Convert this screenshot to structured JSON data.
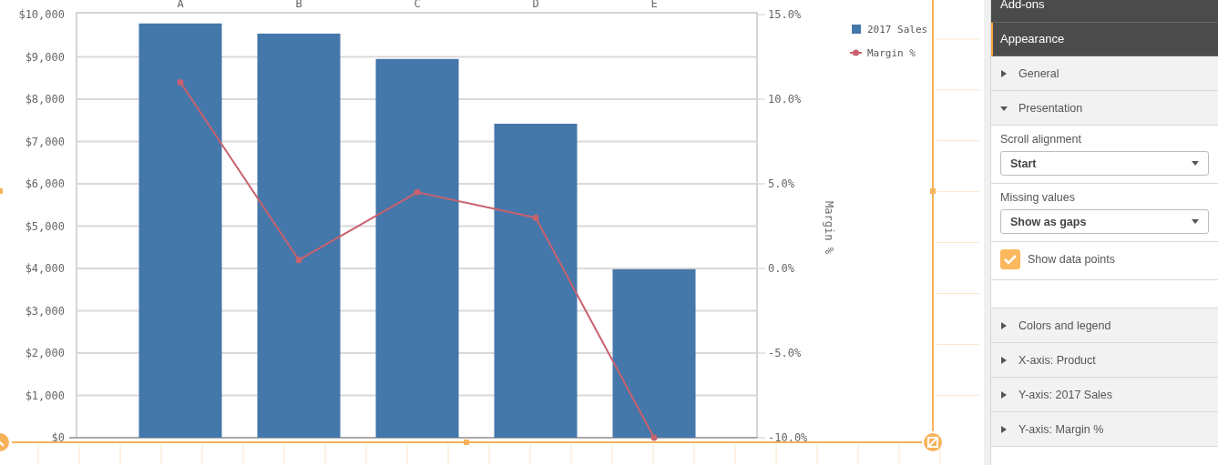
{
  "chart": {
    "chart_data": {
      "type": "bar",
      "categories": [
        "A",
        "B",
        "C",
        "D",
        "E"
      ],
      "series": [
        {
          "name": "2017 Sales",
          "color": "#4477aa",
          "values": [
            9790,
            9550,
            8950,
            7420,
            3980
          ]
        },
        {
          "name": "Margin %",
          "type": "line",
          "marker": "circle",
          "axis": "y2",
          "color": "#c8616e",
          "values": [
            11,
            0.5,
            4.5,
            3,
            -10
          ]
        }
      ],
      "grid": true,
      "legend": "right",
      "ylim": [
        0,
        10000
      ],
      "yticks": [
        {
          "value": 0,
          "label": "$0"
        },
        {
          "value": 1000,
          "label": "$1,000"
        },
        {
          "value": 2000,
          "label": "$2,000"
        },
        {
          "value": 3000,
          "label": "$3,000"
        },
        {
          "value": 4000,
          "label": "$4,000"
        },
        {
          "value": 5000,
          "label": "$5,000"
        },
        {
          "value": 6000,
          "label": "$6,000"
        },
        {
          "value": 7000,
          "label": "$7,000"
        },
        {
          "value": 8000,
          "label": "$8,000"
        },
        {
          "value": 9000,
          "label": "$9,000"
        },
        {
          "value": 10000,
          "label": "$10,000"
        }
      ],
      "y2label": "Margin %",
      "y2lim": [
        -10,
        15
      ],
      "y2ticks": [
        {
          "value": 15,
          "label": "15.0%"
        },
        {
          "value": 10,
          "label": "10.0%"
        },
        {
          "value": 5,
          "label": "5.0%"
        },
        {
          "value": 0,
          "label": "0.0%"
        },
        {
          "value": -5,
          "label": "-5.0%"
        },
        {
          "value": -10,
          "label": "-10.0%"
        }
      ]
    }
  },
  "panel": {
    "tabs": [
      {
        "label": "Add-ons",
        "selected": false
      },
      {
        "label": "Appearance",
        "selected": true
      }
    ],
    "sections": [
      {
        "label": "General",
        "expanded": false
      },
      {
        "label": "Presentation",
        "expanded": true,
        "children": [
          {
            "kind": "dropdown",
            "label": "Scroll alignment",
            "value": "Start"
          },
          {
            "kind": "dropdown",
            "label": "Missing values",
            "value": "Show as gaps"
          },
          {
            "kind": "checkbox",
            "label": "Show data points",
            "checked": true
          }
        ]
      },
      {
        "label": "Colors and legend",
        "expanded": false
      },
      {
        "label": "X-axis: Product",
        "expanded": false
      },
      {
        "label": "Y-axis: 2017 Sales",
        "expanded": false
      },
      {
        "label": "Y-axis: Margin %",
        "expanded": false
      }
    ]
  }
}
